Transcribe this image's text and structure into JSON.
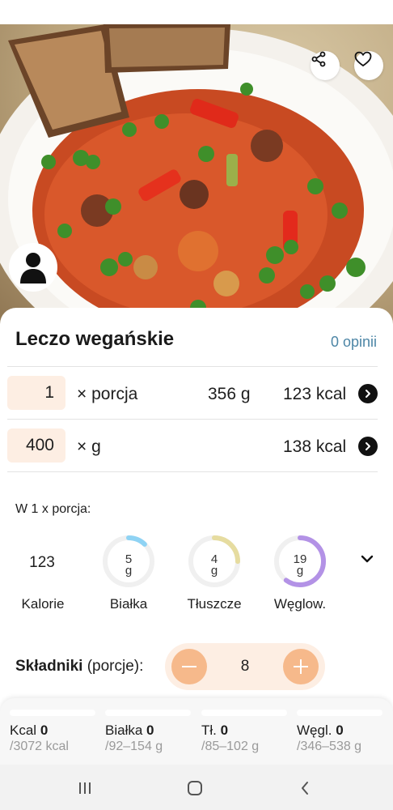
{
  "recipe": {
    "title": "Leczo wegańskie",
    "reviews": "0 opinii"
  },
  "portion_row": {
    "quantity": "1",
    "unit": "× porcja",
    "weight": "356 g",
    "kcal": "123 kcal"
  },
  "gram_row": {
    "quantity": "400",
    "unit": "× g",
    "kcal": "138 kcal"
  },
  "nutrition": {
    "per_label": "W 1 x porcja:",
    "calories": {
      "value": "123",
      "label": "Kalorie"
    },
    "items": [
      {
        "value": "5",
        "unit": "g",
        "label": "Białka",
        "color": "#8fd3f4",
        "fraction": 0.12
      },
      {
        "value": "4",
        "unit": "g",
        "label": "Tłuszcze",
        "color": "#e6dca0",
        "fraction": 0.25
      },
      {
        "value": "19",
        "unit": "g",
        "label": "Węglow.",
        "color": "#b392e6",
        "fraction": 0.6
      }
    ]
  },
  "ingredients": {
    "label_bold": "Składniki",
    "label_rest": " (porcje):",
    "servings": "8"
  },
  "summary": [
    {
      "name": "Kcal",
      "value": "0",
      "range": "/3072 kcal"
    },
    {
      "name": "Białka",
      "value": "0",
      "range": "/92–154 g"
    },
    {
      "name": "Tł.",
      "value": "0",
      "range": "/85–102 g"
    },
    {
      "name": "Węgl.",
      "value": "0",
      "range": "/346–538 g"
    }
  ],
  "icons": {
    "share": "share-icon",
    "heart": "heart-icon",
    "avatar": "user-icon",
    "arrow": "arrow-right-icon",
    "chevron": "chevron-down-icon",
    "minus": "minus-icon",
    "plus": "plus-icon",
    "nav_recents": "recents-icon",
    "nav_home": "home-icon",
    "nav_back": "back-icon"
  },
  "colors": {
    "accent_soft": "#fdeee3",
    "accent": "#f6b98b",
    "link": "#4d86a6"
  }
}
